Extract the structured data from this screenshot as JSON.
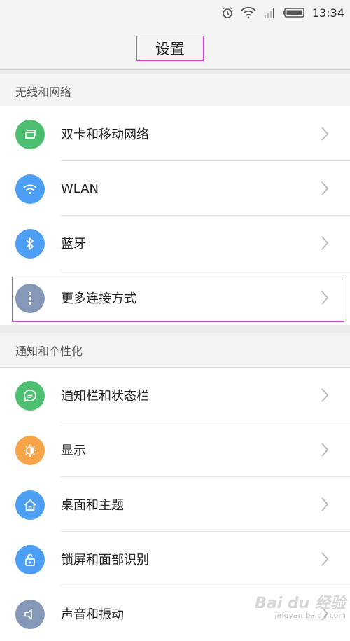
{
  "status_bar": {
    "time": "13:34"
  },
  "header": {
    "title": "设置"
  },
  "sections": [
    {
      "header": "无线和网络",
      "items": [
        {
          "label": "双卡和移动网络",
          "icon": "sim-card-icon",
          "color": "#4cc070"
        },
        {
          "label": "WLAN",
          "icon": "wifi-icon",
          "color": "#4d9ff5"
        },
        {
          "label": "蓝牙",
          "icon": "bluetooth-icon",
          "color": "#4d9ff5"
        },
        {
          "label": "更多连接方式",
          "icon": "more-dots-icon",
          "color": "#8598b8"
        }
      ]
    },
    {
      "header": "通知和个性化",
      "items": [
        {
          "label": "通知栏和状态栏",
          "icon": "chat-bubble-icon",
          "color": "#4cc070"
        },
        {
          "label": "显示",
          "icon": "brightness-icon",
          "color": "#f7a348"
        },
        {
          "label": "桌面和主题",
          "icon": "home-icon",
          "color": "#4d9ff5"
        },
        {
          "label": "锁屏和面部识别",
          "icon": "lock-icon",
          "color": "#4d9ff5"
        },
        {
          "label": "声音和振动",
          "icon": "speaker-icon",
          "color": "#8598b8"
        }
      ]
    }
  ],
  "watermark": {
    "logo": "Bai du 经验",
    "url": "jingyan.baidu.com"
  }
}
